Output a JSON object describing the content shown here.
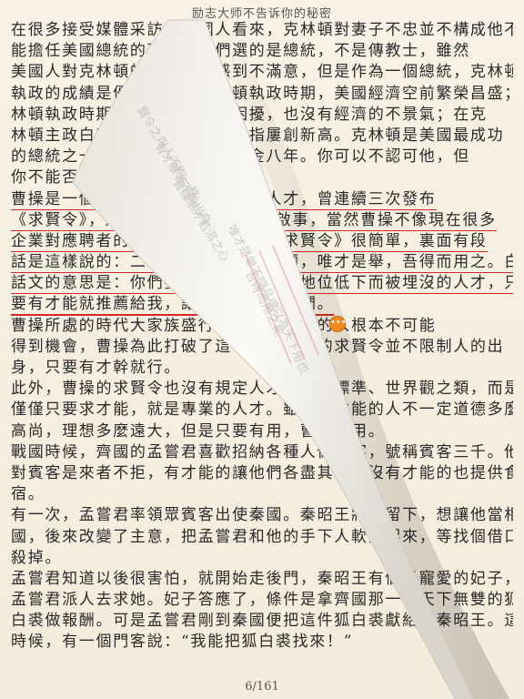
{
  "header": {
    "title": "励志大师不告诉你的秘密"
  },
  "footer": {
    "page_indicator": "6/161"
  },
  "lines": [
    {
      "text": "在很多接受媒體采訪的美國人看來，克林頓對妻子不忠並不構成他不",
      "ul": false
    },
    {
      "text": "能擔任美國總統的理由，他們選的是總統，不是傳教士，雖然",
      "ul": false
    },
    {
      "text": "美國人對克林頓的越軌行為感到不滿意，但是作為一個總統，克林頓",
      "ul": false
    },
    {
      "text": "執政的成績是優秀的，在克林頓執政時期，美國經濟空前繁榮昌盛；在",
      "ul": false
    },
    {
      "text": "林頓執政時期美國沒有戰爭的困擾，也沒有經濟的不景氣；在克",
      "ul": false
    },
    {
      "text": "林頓主政白宮時，美國股市大股指屢創新高。克林頓是美國最成功",
      "ul": false
    },
    {
      "text": "的總統之一，美國經濟被譽為黃金八年。你可以不認可他，但",
      "ul": false
    },
    {
      "text": "你不能否認他的能力。",
      "ul": false
    },
    {
      "text": "曹操是一個愛才的人，他下，招攬人才，曾連續三次發布",
      "ul": true
    },
    {
      "text": "《求賢令》，用今天的話說就是招聘啟事，當然曹操不像現在很多",
      "ul": true
    },
    {
      "text": "企業對應聘者的要求那麼多，他的《求賢令》很簡單，裏面有段",
      "ul": true
    },
    {
      "text": "話是這樣說的：二三子其佐我明揚仄陋，唯才是舉，吾得而用之。白",
      "ul": true
    },
    {
      "text": "話文的意思是：你們要幫助我發現那些地位低下而被埋沒的人才，只",
      "ul": true
    },
    {
      "text": "要有才能就推薦給我，讓我能夠任用他們。",
      "ul": true
    },
    {
      "text": "曹操所處的時代大家族盛行，那些有才華的人根本不可能",
      "ul": false
    },
    {
      "text": "得到機會，曹操為此打破了這一局面，他的求賢令並不限制人的出",
      "ul": false
    },
    {
      "text": "身，只要有才幹就行。",
      "ul": false
    },
    {
      "text": "此外，曹操的求賢令也沒有規定人才的道德標準、世界觀之類，而是",
      "ul": false
    },
    {
      "text": "僅僅只要求才能，就是專業的人才。雖然有才能的人不一定道德多麼",
      "ul": false
    },
    {
      "text": "高尚，理想多麼遠大，但是只要有用，曹操就用。",
      "ul": false
    },
    {
      "text": "戰國時候，齊國的孟嘗君喜歡招納各種人做門客，號稱賓客三千。他",
      "ul": false
    },
    {
      "text": "對賓客是來者不拒，有才能的讓他們各盡其能，沒有才能的也提供食",
      "ul": false
    },
    {
      "text": "宿。",
      "ul": false
    },
    {
      "text": "有一次，孟嘗君率領眾賓客出使秦國。秦昭王將他留下，想讓他當相",
      "ul": false
    },
    {
      "text": "國，後來改變了主意，把孟嘗君和他的手下人軟禁起來，等找個借口",
      "ul": false
    },
    {
      "text": "殺掉。",
      "ul": false
    },
    {
      "text": "孟嘗君知道以後很害怕，就開始走後門，秦昭王有個最寵愛的妃子，",
      "ul": false
    },
    {
      "text": "孟嘗君派人去求她。妃子答應了，條件是拿齊國那一件天下無雙的狐",
      "ul": false
    },
    {
      "text": "白裘做報酬。可是孟嘗君剛到秦國便把這件狐白裘獻給了秦昭王。這",
      "ul": false
    },
    {
      "text": "時候，有一個門客說：“我能把狐白裘找來！”",
      "ul": false
    }
  ],
  "colors": {
    "underline": "#d42a2a",
    "note": "#f08a1c",
    "paper": "#f6efe0"
  },
  "note": {
    "glyph": "•••"
  }
}
